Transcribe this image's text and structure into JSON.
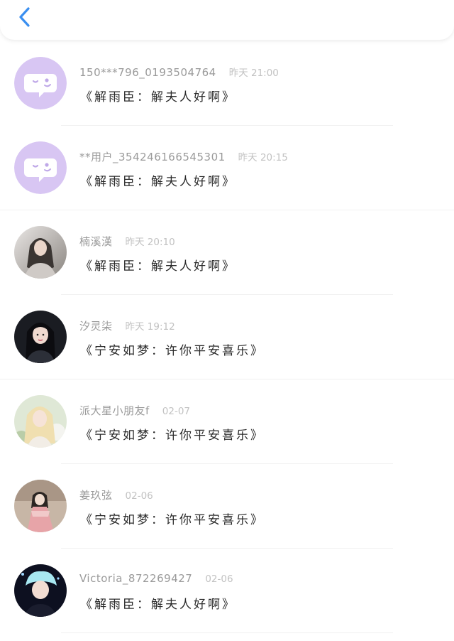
{
  "header": {
    "back_icon": "chevron-left-icon",
    "accent_color": "#3a8ff0"
  },
  "items": [
    {
      "name": "150***796_0193504764",
      "time": "昨天 21:00",
      "message": "《解雨臣：解夫人好啊》",
      "avatar": "default-chat-avatar-icon"
    },
    {
      "name": "**用户_354246166545301",
      "time": "昨天 20:15",
      "message": "《解雨臣：解夫人好啊》",
      "avatar": "default-chat-avatar-icon"
    },
    {
      "name": "楠溪漢",
      "time": "昨天 20:10",
      "message": "《解雨臣：解夫人好啊》",
      "avatar": "user-photo-avatar"
    },
    {
      "name": "汐灵柒",
      "time": "昨天 19:12",
      "message": "《宁安如梦：许你平安喜乐》",
      "avatar": "user-photo-avatar"
    },
    {
      "name": "派大星小朋友f",
      "time": "02-07",
      "message": "《宁安如梦：许你平安喜乐》",
      "avatar": "user-photo-avatar"
    },
    {
      "name": "姜玖弦",
      "time": "02-06",
      "message": "《宁安如梦：许你平安喜乐》",
      "avatar": "user-photo-avatar"
    },
    {
      "name": "Victoria_872269427",
      "time": "02-06",
      "message": "《解雨臣：解夫人好啊》",
      "avatar": "user-photo-avatar"
    }
  ]
}
